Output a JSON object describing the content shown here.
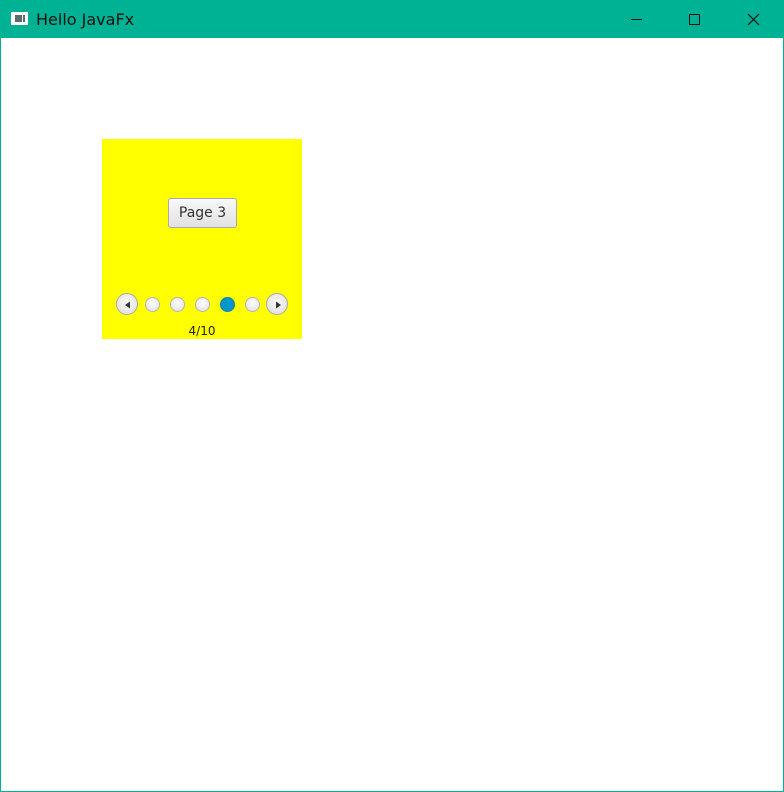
{
  "window": {
    "title": "Hello JavaFx",
    "titlebar_color": "#00b294",
    "icons": [
      "app-icon",
      "minimize-icon",
      "maximize-icon",
      "close-icon"
    ]
  },
  "pagination": {
    "background_color": "#ffff00",
    "page_button_label": "Page 3",
    "page_info": "4/10",
    "current_page": 4,
    "total_pages": 10,
    "visible_indicators": 5,
    "active_indicator_color": "#0096c9",
    "icons": [
      "chevron-left-icon",
      "chevron-right-icon"
    ]
  }
}
